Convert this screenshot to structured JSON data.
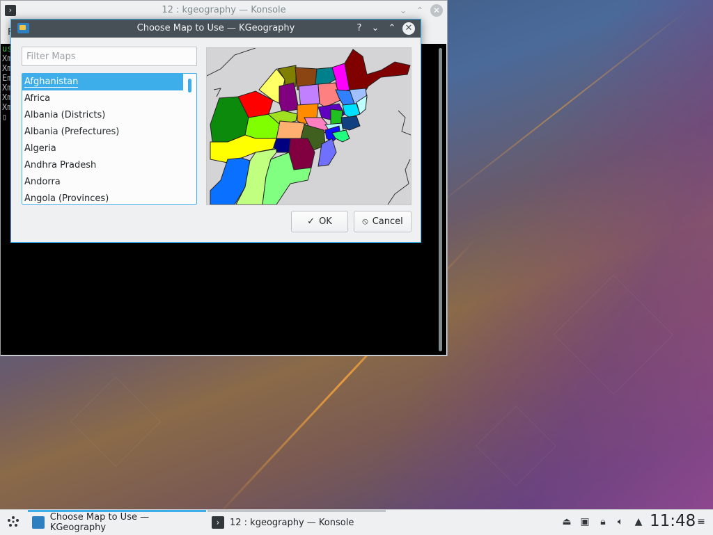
{
  "konsole": {
    "title": "12 : kgeography — Konsole",
    "menu_initial": "F",
    "terminal_lines": [
      "us",
      "Xm",
      "Xm",
      "Em",
      "Xm",
      "Xm",
      "Xm"
    ],
    "cursor": "▯"
  },
  "dialog": {
    "title": "Choose Map to Use — KGeography",
    "buttons": {
      "help": "?",
      "minimize": "⌄",
      "maximize": "⌃",
      "close": "✕"
    },
    "filter_placeholder": "Filter Maps",
    "maps": [
      "Afghanistan",
      "Africa",
      "Albania (Districts)",
      "Albania (Prefectures)",
      "Algeria",
      "Andhra Pradesh",
      "Andorra",
      "Angola (Provinces)"
    ],
    "selected_index": 0,
    "ok_label": "OK",
    "cancel_label": "Cancel"
  },
  "taskbar": {
    "tasks": [
      {
        "label": "Choose Map to Use — KGeography",
        "active": true
      },
      {
        "label": "12 : kgeography — Konsole",
        "active": false
      }
    ],
    "clock": "11:48"
  },
  "colors": {
    "accent": "#3daee9",
    "dialog_titlebar": "#475057",
    "panel_bg": "#eff0f1"
  }
}
